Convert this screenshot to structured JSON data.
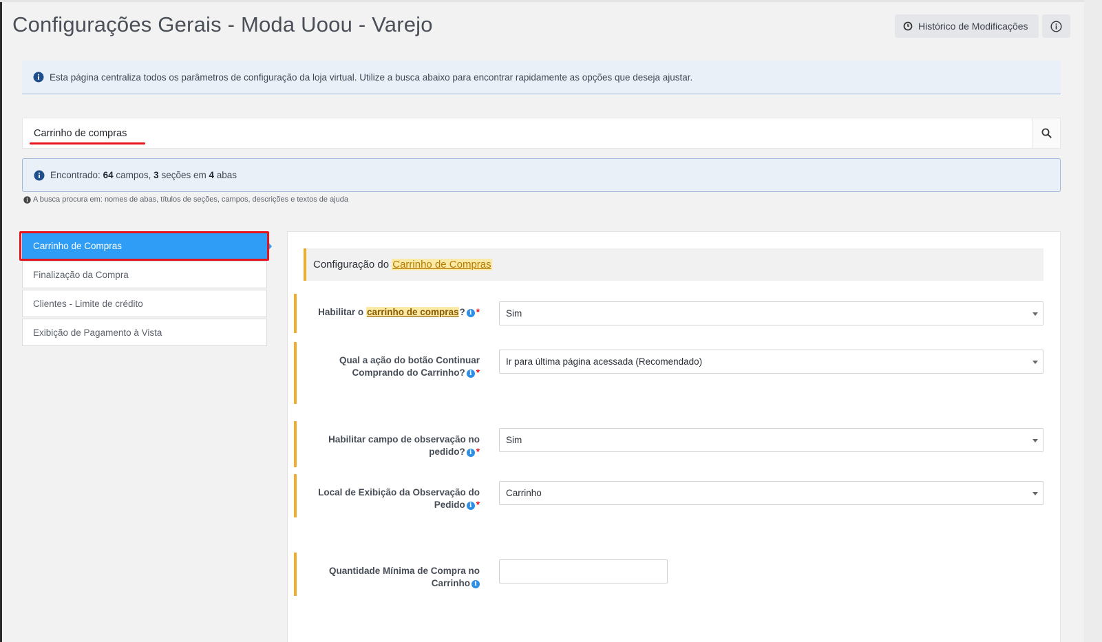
{
  "page": {
    "title": "Configurações Gerais - Moda Uoou - Varejo"
  },
  "header": {
    "history_label": "Histórico de Modificações",
    "history_icon": "clock-icon",
    "info_icon": "info-icon"
  },
  "notice": {
    "text": "Esta página centraliza todos os parâmetros de configuração da loja virtual. Utilize a busca abaixo para encontrar rapidamente as opções que deseja ajustar."
  },
  "search": {
    "value": "Carrinho de compras",
    "icon": "search-icon"
  },
  "results": {
    "prefix": "Encontrado:",
    "fields_count": "64",
    "fields_word": "campos,",
    "sections_count": "3",
    "sections_word": "seções em",
    "tabs_count": "4",
    "tabs_word": "abas",
    "hint": "A busca procura em: nomes de abas, títulos de seções, campos, descrições e textos de ajuda"
  },
  "tabs": [
    {
      "label": "Carrinho de Compras",
      "active": true
    },
    {
      "label": "Finalização da Compra",
      "active": false
    },
    {
      "label": "Clientes - Limite de crédito",
      "active": false
    },
    {
      "label": "Exibição de Pagamento à Vista",
      "active": false
    }
  ],
  "section": {
    "prefix": "Configuração do",
    "highlight": "Carrinho de Compras"
  },
  "fields": {
    "f1": {
      "label_prefix": "Habilitar o",
      "label_highlight": "carrinho de compras",
      "label_suffix": "?",
      "value": "Sim",
      "required": true
    },
    "f2": {
      "label_line1": "Qual a ação do botão Continuar",
      "label_line2": "Comprando do Carrinho?",
      "value": "Ir para última página acessada (Recomendado)",
      "required": true
    },
    "f3": {
      "label_line1": "Habilitar campo de observação no",
      "label_line2": "pedido?",
      "value": "Sim",
      "required": true
    },
    "f4": {
      "label_line1": "Local de Exibição da Observação do",
      "label_line2": "Pedido",
      "value": "Carrinho",
      "required": true
    },
    "f5": {
      "label_line1": "Quantidade Mínima de Compra no",
      "label_line2": "Carrinho",
      "value": "",
      "required": false
    }
  },
  "colors": {
    "accent_blue": "#2f9df5",
    "highlight_bar": "#f0ad2d",
    "annotation_red": "#e8141c"
  }
}
